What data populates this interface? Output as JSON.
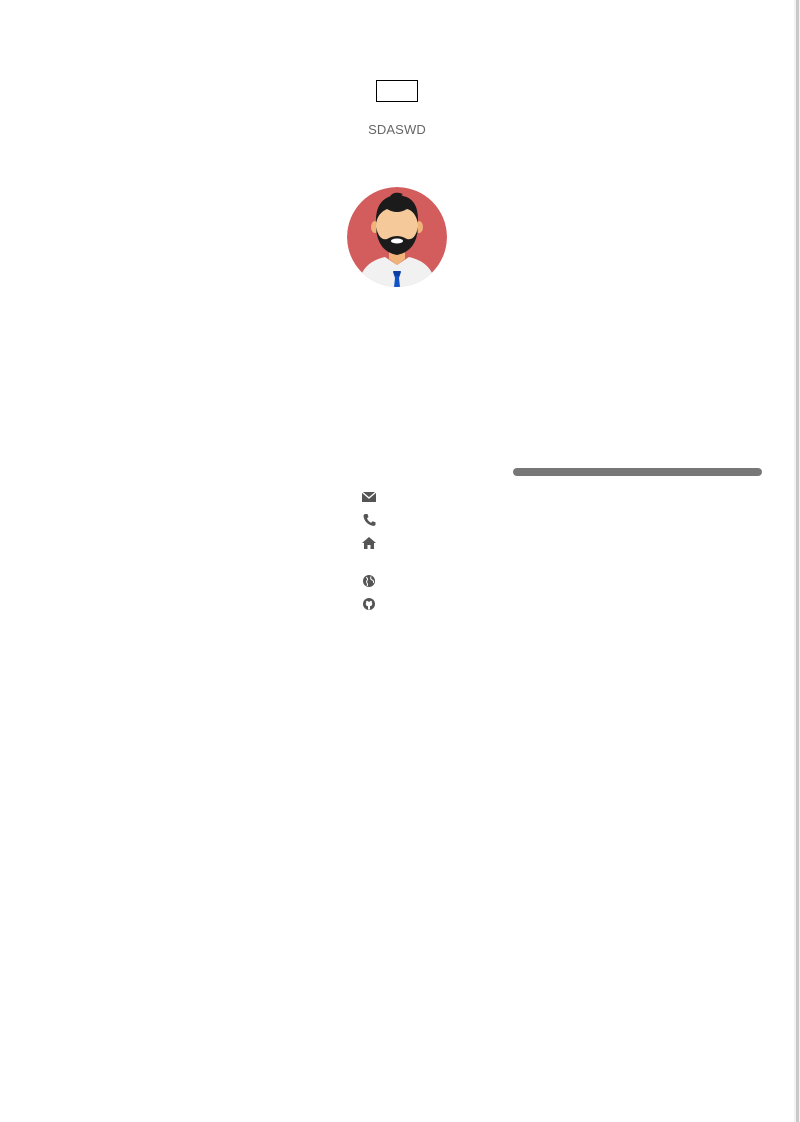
{
  "profile": {
    "subtitle": "SDASWD",
    "avatar_colors": {
      "background": "#d35d5d",
      "skin": "#f6c99a",
      "hair": "#1b1b1b",
      "shirt": "#f1f1f1",
      "tie": "#1152c6"
    }
  },
  "skills": {
    "progress_fill": 1.0,
    "bar_color": "#777777"
  },
  "contact_icons": [
    "envelope-icon",
    "phone-icon",
    "home-icon",
    "globe-icon",
    "github-icon"
  ]
}
